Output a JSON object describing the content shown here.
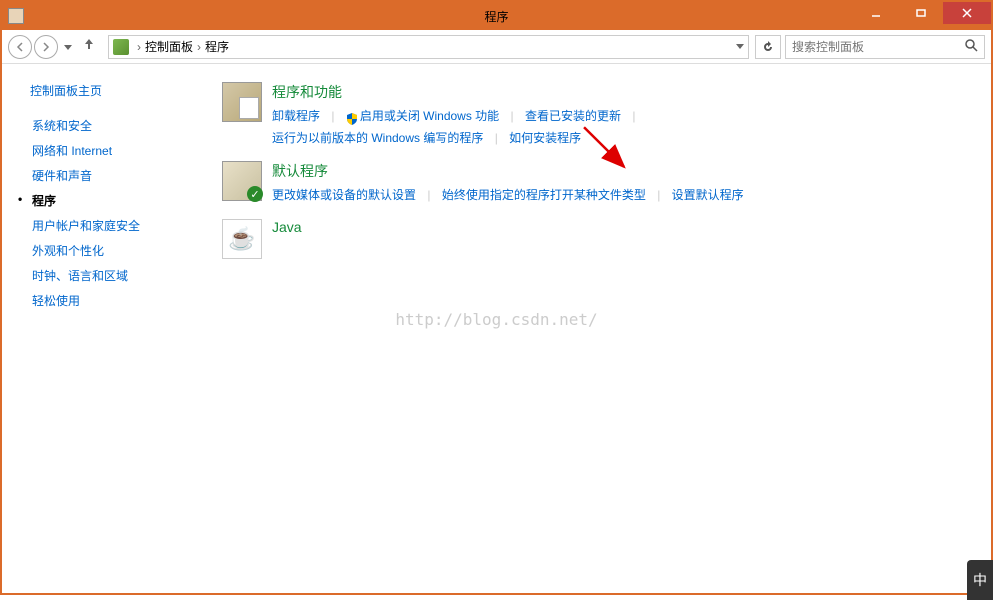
{
  "window": {
    "title": "程序"
  },
  "breadcrumb": {
    "root": "控制面板",
    "current": "程序"
  },
  "search": {
    "placeholder": "搜索控制面板"
  },
  "sidebar": {
    "home": "控制面板主页",
    "items": [
      {
        "label": "系统和安全",
        "current": false
      },
      {
        "label": "网络和 Internet",
        "current": false
      },
      {
        "label": "硬件和声音",
        "current": false
      },
      {
        "label": "程序",
        "current": true
      },
      {
        "label": "用户帐户和家庭安全",
        "current": false
      },
      {
        "label": "外观和个性化",
        "current": false
      },
      {
        "label": "时钟、语言和区域",
        "current": false
      },
      {
        "label": "轻松使用",
        "current": false
      }
    ]
  },
  "categories": {
    "programs": {
      "title": "程序和功能",
      "links": {
        "uninstall": "卸载程序",
        "features": "启用或关闭 Windows 功能",
        "updates": "查看已安装的更新",
        "oldversion": "运行为以前版本的 Windows 编写的程序",
        "howto": "如何安装程序"
      }
    },
    "defaults": {
      "title": "默认程序",
      "links": {
        "media": "更改媒体或设备的默认设置",
        "filetypes": "始终使用指定的程序打开某种文件类型",
        "setdefaults": "设置默认程序"
      }
    },
    "java": {
      "title": "Java"
    }
  },
  "watermark": "http://blog.csdn.net/",
  "ime": "中"
}
